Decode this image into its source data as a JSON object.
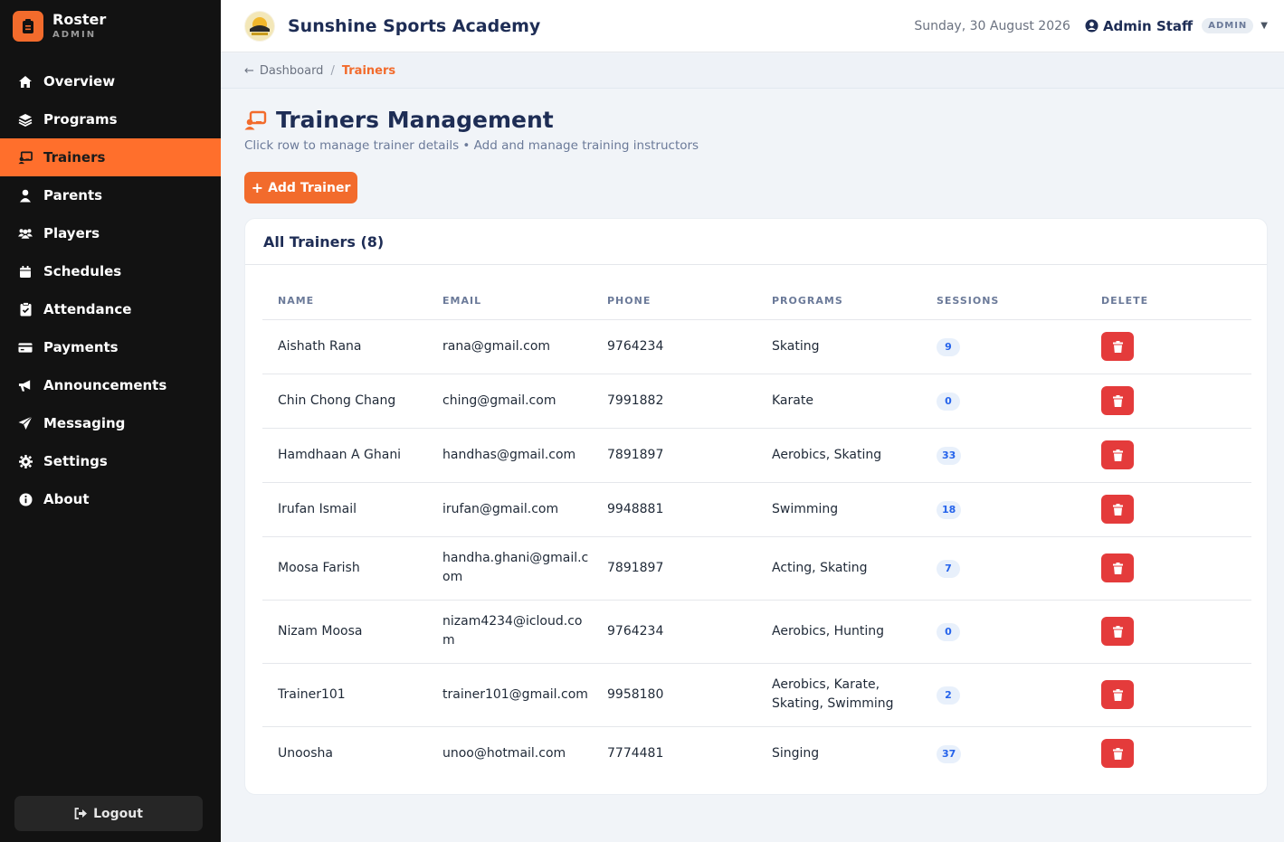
{
  "brand": {
    "name": "Roster",
    "sub": "ADMIN"
  },
  "sidebar": {
    "items": [
      {
        "label": "Overview",
        "icon": "home-icon"
      },
      {
        "label": "Programs",
        "icon": "layers-icon"
      },
      {
        "label": "Trainers",
        "icon": "chalkboard-icon",
        "active": true
      },
      {
        "label": "Parents",
        "icon": "user-icon"
      },
      {
        "label": "Players",
        "icon": "users-icon"
      },
      {
        "label": "Schedules",
        "icon": "calendar-icon"
      },
      {
        "label": "Attendance",
        "icon": "clipboard-icon"
      },
      {
        "label": "Payments",
        "icon": "credit-card-icon"
      },
      {
        "label": "Announcements",
        "icon": "megaphone-icon"
      },
      {
        "label": "Messaging",
        "icon": "paper-plane-icon"
      },
      {
        "label": "Settings",
        "icon": "gear-icon"
      },
      {
        "label": "About",
        "icon": "info-icon"
      }
    ],
    "logout_label": "Logout"
  },
  "topbar": {
    "academy_name": "Sunshine Sports Academy",
    "date": "Sunday, 30 August 2026",
    "user_name": "Admin Staff",
    "role": "ADMIN"
  },
  "breadcrumb": {
    "parent": "Dashboard",
    "current": "Trainers"
  },
  "page": {
    "title": "Trainers Management",
    "subtitle": "Click row to manage trainer details • Add and manage training instructors",
    "add_button": "Add Trainer"
  },
  "card": {
    "title": "All Trainers (8)"
  },
  "table": {
    "headers": [
      "NAME",
      "EMAIL",
      "PHONE",
      "PROGRAMS",
      "SESSIONS",
      "DELETE"
    ],
    "rows": [
      {
        "name": "Aishath Rana",
        "email": "rana@gmail.com",
        "phone": "9764234",
        "programs": "Skating",
        "sessions": "9"
      },
      {
        "name": "Chin Chong Chang",
        "email": "ching@gmail.com",
        "phone": "7991882",
        "programs": "Karate",
        "sessions": "0"
      },
      {
        "name": "Hamdhaan A Ghani",
        "email": "handhas@gmail.com",
        "phone": "7891897",
        "programs": "Aerobics, Skating",
        "sessions": "33"
      },
      {
        "name": "Irufan Ismail",
        "email": "irufan@gmail.com",
        "phone": "9948881",
        "programs": "Swimming",
        "sessions": "18"
      },
      {
        "name": "Moosa Farish",
        "email": "handha.ghani@gmail.com",
        "phone": "7891897",
        "programs": "Acting, Skating",
        "sessions": "7"
      },
      {
        "name": "Nizam Moosa",
        "email": "nizam4234@icloud.com",
        "phone": "9764234",
        "programs": "Aerobics, Hunting",
        "sessions": "0"
      },
      {
        "name": "Trainer101",
        "email": "trainer101@gmail.com",
        "phone": "9958180",
        "programs": "Aerobics, Karate, Skating, Swimming",
        "sessions": "2"
      },
      {
        "name": "Unoosha",
        "email": "unoo@hotmail.com",
        "phone": "7774481",
        "programs": "Singing",
        "sessions": "37"
      }
    ]
  },
  "colors": {
    "accent": "#ff6f2c",
    "sidebar_bg": "#121212",
    "danger": "#e43b3b",
    "navy": "#1e2d55"
  }
}
